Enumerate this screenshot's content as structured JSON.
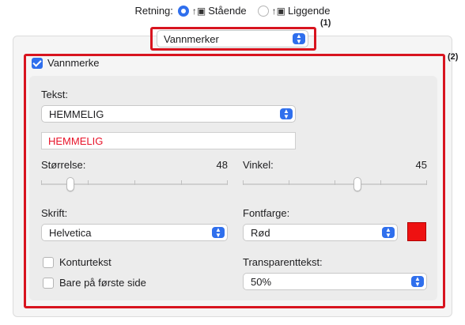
{
  "orientation": {
    "label": "Retning:",
    "options": [
      {
        "icon": "portrait-icon",
        "label": "Stående",
        "selected": true
      },
      {
        "icon": "landscape-icon",
        "label": "Liggende",
        "selected": false
      }
    ]
  },
  "callouts": {
    "one": "(1)",
    "two": "(2)"
  },
  "mode_select": {
    "value": "Vannmerker"
  },
  "watermark": {
    "enabled": true,
    "label": "Vannmerke",
    "text_label": "Tekst:",
    "text_select": "HEMMELIG",
    "text_input": "HEMMELIG",
    "size_label": "Størrelse:",
    "size_value": "48",
    "angle_label": "Vinkel:",
    "angle_value": "45",
    "font_label": "Skrift:",
    "font_select": "Helvetica",
    "color_label": "Fontfarge:",
    "color_select": "Rød",
    "color_swatch": "#ee1111",
    "outline_label": "Konturtekst",
    "outline_checked": false,
    "first_page_label": "Bare på første side",
    "first_page_checked": false,
    "transparency_label": "Transparenttekst:",
    "transparency_select": "50%"
  },
  "colors": {
    "accent": "#2f6fed",
    "highlight": "#d8141f",
    "text_red": "#e8142a"
  }
}
